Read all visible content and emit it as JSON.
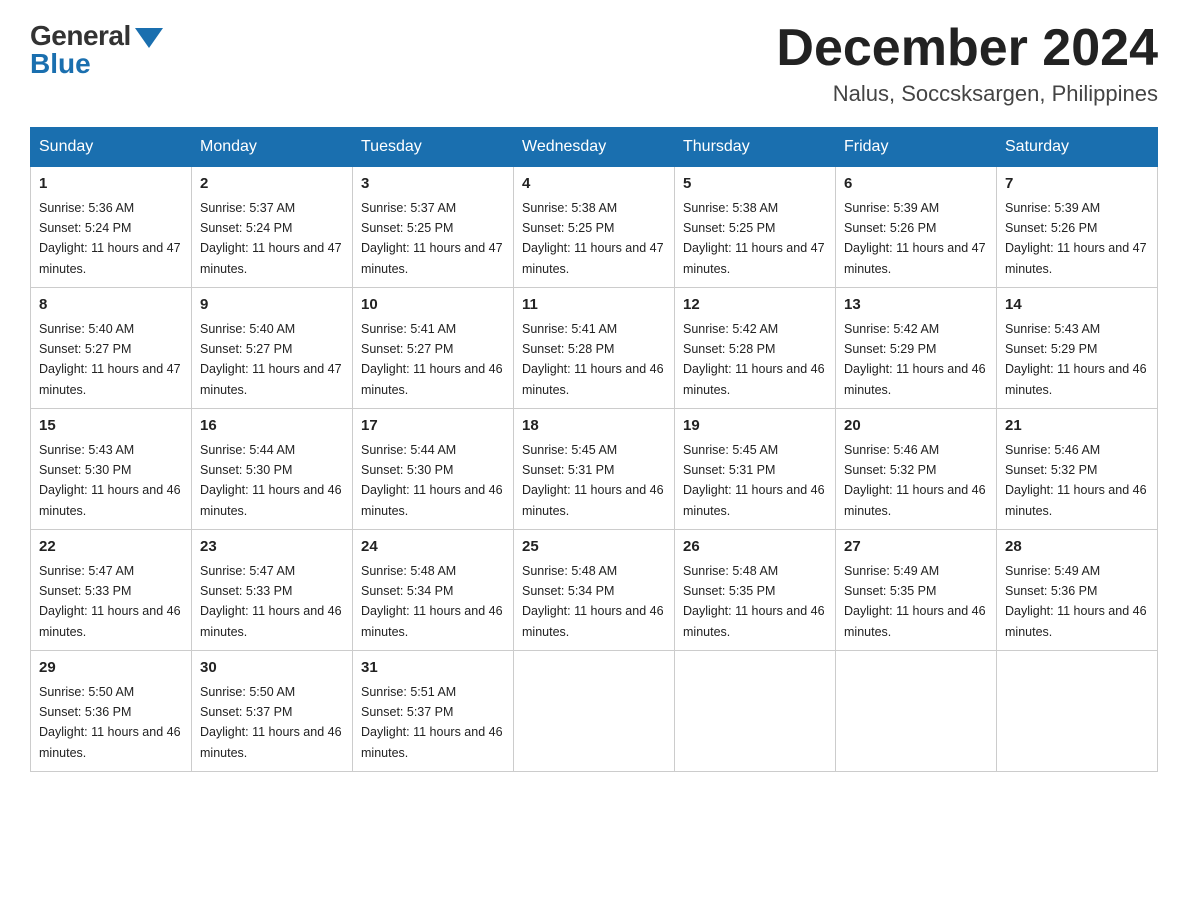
{
  "header": {
    "logo_general": "General",
    "logo_blue": "Blue",
    "month_title": "December 2024",
    "location": "Nalus, Soccsksargen, Philippines"
  },
  "weekdays": [
    "Sunday",
    "Monday",
    "Tuesday",
    "Wednesday",
    "Thursday",
    "Friday",
    "Saturday"
  ],
  "weeks": [
    [
      {
        "day": "1",
        "sunrise": "5:36 AM",
        "sunset": "5:24 PM",
        "daylight": "11 hours and 47 minutes."
      },
      {
        "day": "2",
        "sunrise": "5:37 AM",
        "sunset": "5:24 PM",
        "daylight": "11 hours and 47 minutes."
      },
      {
        "day": "3",
        "sunrise": "5:37 AM",
        "sunset": "5:25 PM",
        "daylight": "11 hours and 47 minutes."
      },
      {
        "day": "4",
        "sunrise": "5:38 AM",
        "sunset": "5:25 PM",
        "daylight": "11 hours and 47 minutes."
      },
      {
        "day": "5",
        "sunrise": "5:38 AM",
        "sunset": "5:25 PM",
        "daylight": "11 hours and 47 minutes."
      },
      {
        "day": "6",
        "sunrise": "5:39 AM",
        "sunset": "5:26 PM",
        "daylight": "11 hours and 47 minutes."
      },
      {
        "day": "7",
        "sunrise": "5:39 AM",
        "sunset": "5:26 PM",
        "daylight": "11 hours and 47 minutes."
      }
    ],
    [
      {
        "day": "8",
        "sunrise": "5:40 AM",
        "sunset": "5:27 PM",
        "daylight": "11 hours and 47 minutes."
      },
      {
        "day": "9",
        "sunrise": "5:40 AM",
        "sunset": "5:27 PM",
        "daylight": "11 hours and 47 minutes."
      },
      {
        "day": "10",
        "sunrise": "5:41 AM",
        "sunset": "5:27 PM",
        "daylight": "11 hours and 46 minutes."
      },
      {
        "day": "11",
        "sunrise": "5:41 AM",
        "sunset": "5:28 PM",
        "daylight": "11 hours and 46 minutes."
      },
      {
        "day": "12",
        "sunrise": "5:42 AM",
        "sunset": "5:28 PM",
        "daylight": "11 hours and 46 minutes."
      },
      {
        "day": "13",
        "sunrise": "5:42 AM",
        "sunset": "5:29 PM",
        "daylight": "11 hours and 46 minutes."
      },
      {
        "day": "14",
        "sunrise": "5:43 AM",
        "sunset": "5:29 PM",
        "daylight": "11 hours and 46 minutes."
      }
    ],
    [
      {
        "day": "15",
        "sunrise": "5:43 AM",
        "sunset": "5:30 PM",
        "daylight": "11 hours and 46 minutes."
      },
      {
        "day": "16",
        "sunrise": "5:44 AM",
        "sunset": "5:30 PM",
        "daylight": "11 hours and 46 minutes."
      },
      {
        "day": "17",
        "sunrise": "5:44 AM",
        "sunset": "5:30 PM",
        "daylight": "11 hours and 46 minutes."
      },
      {
        "day": "18",
        "sunrise": "5:45 AM",
        "sunset": "5:31 PM",
        "daylight": "11 hours and 46 minutes."
      },
      {
        "day": "19",
        "sunrise": "5:45 AM",
        "sunset": "5:31 PM",
        "daylight": "11 hours and 46 minutes."
      },
      {
        "day": "20",
        "sunrise": "5:46 AM",
        "sunset": "5:32 PM",
        "daylight": "11 hours and 46 minutes."
      },
      {
        "day": "21",
        "sunrise": "5:46 AM",
        "sunset": "5:32 PM",
        "daylight": "11 hours and 46 minutes."
      }
    ],
    [
      {
        "day": "22",
        "sunrise": "5:47 AM",
        "sunset": "5:33 PM",
        "daylight": "11 hours and 46 minutes."
      },
      {
        "day": "23",
        "sunrise": "5:47 AM",
        "sunset": "5:33 PM",
        "daylight": "11 hours and 46 minutes."
      },
      {
        "day": "24",
        "sunrise": "5:48 AM",
        "sunset": "5:34 PM",
        "daylight": "11 hours and 46 minutes."
      },
      {
        "day": "25",
        "sunrise": "5:48 AM",
        "sunset": "5:34 PM",
        "daylight": "11 hours and 46 minutes."
      },
      {
        "day": "26",
        "sunrise": "5:48 AM",
        "sunset": "5:35 PM",
        "daylight": "11 hours and 46 minutes."
      },
      {
        "day": "27",
        "sunrise": "5:49 AM",
        "sunset": "5:35 PM",
        "daylight": "11 hours and 46 minutes."
      },
      {
        "day": "28",
        "sunrise": "5:49 AM",
        "sunset": "5:36 PM",
        "daylight": "11 hours and 46 minutes."
      }
    ],
    [
      {
        "day": "29",
        "sunrise": "5:50 AM",
        "sunset": "5:36 PM",
        "daylight": "11 hours and 46 minutes."
      },
      {
        "day": "30",
        "sunrise": "5:50 AM",
        "sunset": "5:37 PM",
        "daylight": "11 hours and 46 minutes."
      },
      {
        "day": "31",
        "sunrise": "5:51 AM",
        "sunset": "5:37 PM",
        "daylight": "11 hours and 46 minutes."
      },
      null,
      null,
      null,
      null
    ]
  ],
  "labels": {
    "sunrise_prefix": "Sunrise: ",
    "sunset_prefix": "Sunset: ",
    "daylight_prefix": "Daylight: "
  }
}
